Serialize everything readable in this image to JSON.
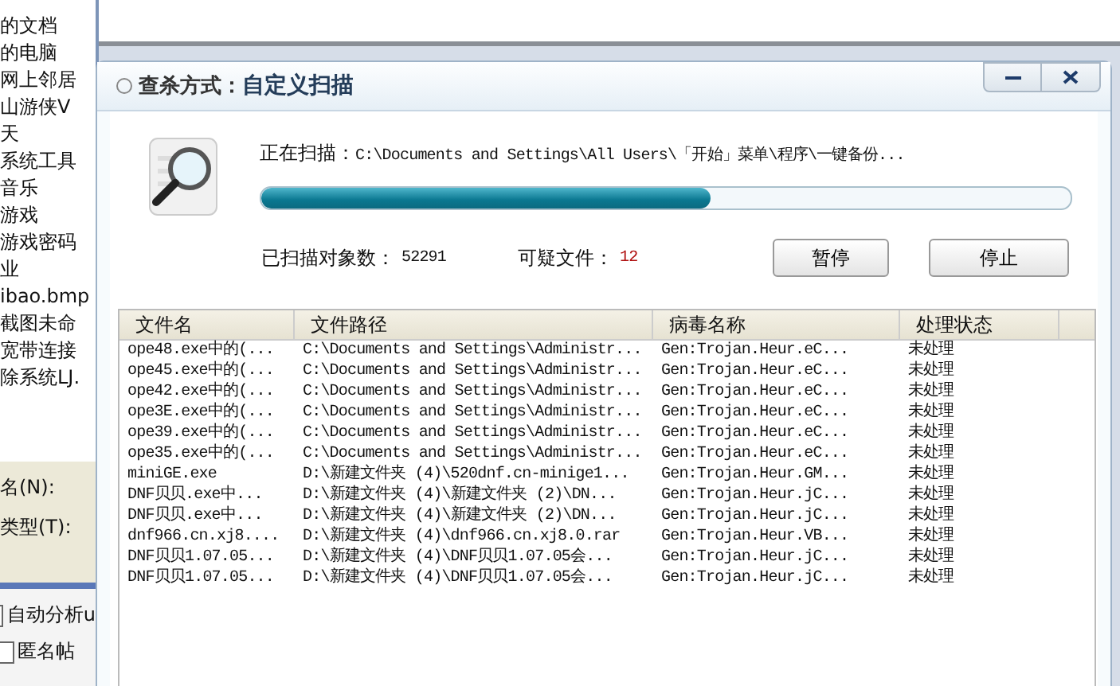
{
  "background": {
    "items": [
      "的文档",
      "的电脑",
      "网上邻居",
      "山游侠V",
      "天",
      "系统工具",
      "音乐",
      "游戏",
      "游戏密码",
      "业",
      "ibao.bmp",
      "截图未命",
      "宽带连接",
      "除系统LJ."
    ],
    "fields": [
      {
        "label": "名(N):"
      },
      {
        "label": "类型(T):"
      }
    ],
    "options": [
      {
        "label": "自动分析u",
        "checked": false
      },
      {
        "label": "匿名帖",
        "checked": false
      }
    ]
  },
  "dialog": {
    "mode_label": "查杀方式：",
    "title": "自定义扫描",
    "scanning_label": "正在扫描：",
    "scanning_path": "C:\\Documents and Settings\\All Users\\「开始」菜单\\程序\\一键备份...",
    "progress": {
      "level": 0.555
    },
    "scanned_label": "已扫描对象数：",
    "scanned_count": "52291",
    "suspicious_label": "可疑文件：",
    "suspicious_count": "12",
    "buttons": [
      "暂停",
      "停止"
    ],
    "table": {
      "columns": [
        "文件名",
        "文件路径",
        "病毒名称",
        "处理状态"
      ],
      "rows": [
        [
          "ope48.exe中的(...",
          "C:\\Documents and Settings\\Administr...",
          "Gen:Trojan.Heur.eC...",
          "未处理"
        ],
        [
          "ope45.exe中的(...",
          "C:\\Documents and Settings\\Administr...",
          "Gen:Trojan.Heur.eC...",
          "未处理"
        ],
        [
          "ope42.exe中的(...",
          "C:\\Documents and Settings\\Administr...",
          "Gen:Trojan.Heur.eC...",
          "未处理"
        ],
        [
          "ope3E.exe中的(...",
          "C:\\Documents and Settings\\Administr...",
          "Gen:Trojan.Heur.eC...",
          "未处理"
        ],
        [
          "ope39.exe中的(...",
          "C:\\Documents and Settings\\Administr...",
          "Gen:Trojan.Heur.eC...",
          "未处理"
        ],
        [
          "ope35.exe中的(...",
          "C:\\Documents and Settings\\Administr...",
          "Gen:Trojan.Heur.eC...",
          "未处理"
        ],
        [
          "miniGE.exe",
          "D:\\新建文件夹 (4)\\520dnf.cn-minige1...",
          "Gen:Trojan.Heur.GM...",
          "未处理"
        ],
        [
          "DNF贝贝.exe中...",
          "D:\\新建文件夹 (4)\\新建文件夹 (2)\\DN...",
          "Gen:Trojan.Heur.jC...",
          "未处理"
        ],
        [
          "DNF贝贝.exe中...",
          "D:\\新建文件夹 (4)\\新建文件夹 (2)\\DN...",
          "Gen:Trojan.Heur.jC...",
          "未处理"
        ],
        [
          "dnf966.cn.xj8....",
          "D:\\新建文件夹 (4)\\dnf966.cn.xj8.0.rar",
          "Gen:Trojan.Heur.VB...",
          "未处理"
        ],
        [
          "DNF贝贝1.07.05...",
          "D:\\新建文件夹 (4)\\DNF贝贝1.07.05会...",
          "Gen:Trojan.Heur.jC...",
          "未处理"
        ],
        [
          "DNF贝贝1.07.05...",
          "D:\\新建文件夹 (4)\\DNF贝贝1.07.05会...",
          "Gen:Trojan.Heur.jC...",
          "未处理"
        ]
      ]
    }
  }
}
